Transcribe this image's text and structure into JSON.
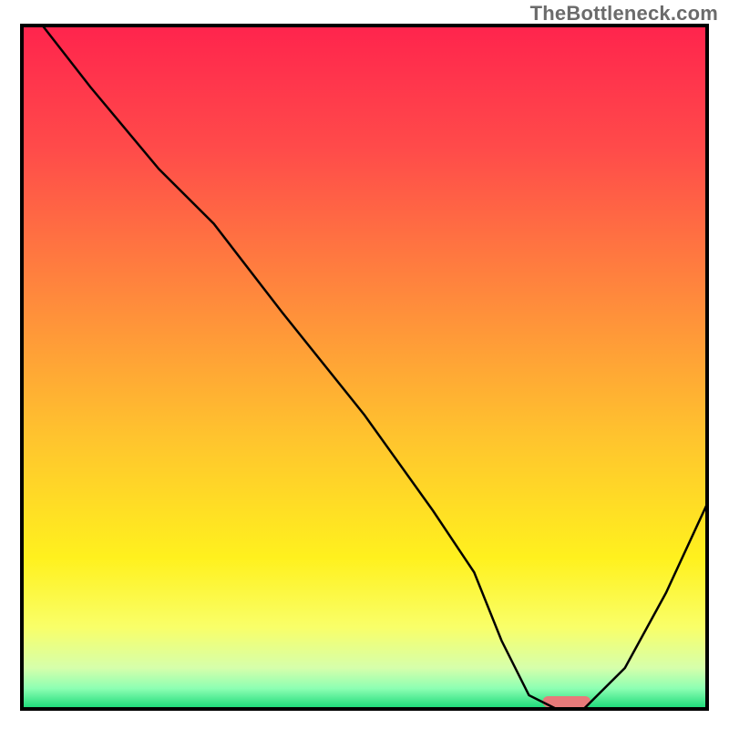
{
  "watermark": "TheBottleneck.com",
  "chart_data": {
    "type": "line",
    "title": "",
    "xlabel": "",
    "ylabel": "",
    "xlim": [
      0,
      100
    ],
    "ylim": [
      0,
      100
    ],
    "x": [
      3,
      10,
      20,
      28,
      38,
      50,
      60,
      66,
      70,
      74,
      78,
      82,
      88,
      94,
      100
    ],
    "values": [
      100,
      91,
      79,
      71,
      58,
      43,
      29,
      20,
      10,
      2,
      0,
      0,
      6,
      17,
      30
    ],
    "optimal_marker": {
      "x_start": 76,
      "x_end": 83,
      "color": "#e77a7a"
    },
    "gradient_stops": [
      {
        "pct": 0,
        "color": "#ff244d"
      },
      {
        "pct": 18,
        "color": "#ff4b4a"
      },
      {
        "pct": 40,
        "color": "#ff8a3c"
      },
      {
        "pct": 60,
        "color": "#ffc32e"
      },
      {
        "pct": 78,
        "color": "#fff11e"
      },
      {
        "pct": 88,
        "color": "#f9ff68"
      },
      {
        "pct": 94,
        "color": "#d6ffab"
      },
      {
        "pct": 97,
        "color": "#8dffb3"
      },
      {
        "pct": 100,
        "color": "#17d876"
      }
    ],
    "frame_color": "#000000",
    "curve_color": "#000000"
  }
}
